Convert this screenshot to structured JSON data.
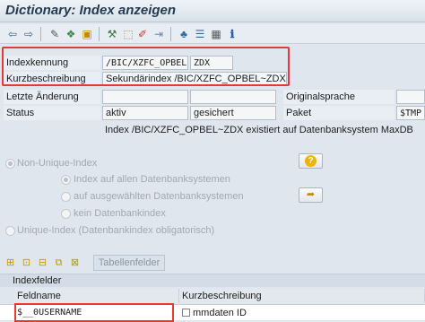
{
  "window": {
    "title": "Dictionary: Index anzeigen"
  },
  "toolbar": {
    "icons": [
      "back-arrow-icon",
      "forward-arrow-icon",
      "tools-icon",
      "object-list-icon",
      "change-icon",
      "activate-icon",
      "pencil-icon",
      "where-used-icon",
      "hierarchy-icon",
      "stack-icon",
      "grid-icon",
      "info-icon"
    ]
  },
  "fields": {
    "indexkennung": {
      "label": "Indexkennung",
      "value_obj": "/BIC/XZFC_OPBEL",
      "value_id": "ZDX"
    },
    "kurzbeschreibung": {
      "label": "Kurzbeschreibung",
      "value": "Sekundärindex /BIC/XZFC_OPBEL~ZDX"
    },
    "letzte_aenderung": {
      "label": "Letzte Änderung",
      "value1": "",
      "value2": ""
    },
    "originalsprache": {
      "label": "Originalsprache"
    },
    "status": {
      "label": "Status",
      "value1": "aktiv",
      "value2": "gesichert"
    },
    "paket": {
      "label": "Paket",
      "value": "$TMP"
    }
  },
  "db_info": "Index /BIC/XZFC_OPBEL~ZDX existiert auf Datenbanksystem MaxDB",
  "options": {
    "non_unique": "Non-Unique-Index",
    "all_db": "Index auf allen Datenbanksystemen",
    "selected_db": "auf ausgewählten Datenbanksystemen",
    "no_db": "kein Datenbankindex",
    "unique": "Unique-Index (Datenbankindex obligatorisch)"
  },
  "buttons": {
    "tabellenfelder": "Tabellenfelder"
  },
  "indexfelder": {
    "title": "Indexfelder",
    "columns": [
      "Feldname",
      "Kurzbeschreibung"
    ],
    "rows": [
      {
        "feldname": "$__0USERNAME",
        "kurzbeschreibung": "mmdaten ID"
      }
    ]
  }
}
